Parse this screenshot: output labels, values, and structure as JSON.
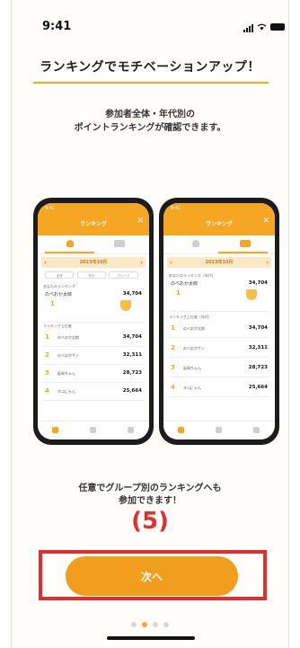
{
  "status_bar": {
    "time": "9:41"
  },
  "page": {
    "title": "ランキングでモチベーションアップ！",
    "description_lines": [
      "参加者全体・年代別の",
      "ポイントランキングが確認できます。"
    ],
    "footer_lines": [
      "任意でグループ別のランキングへも",
      "参加できます！"
    ],
    "step_label": "(5)",
    "next_button": "次へ",
    "page_indicator": {
      "total": 4,
      "active": 2
    }
  },
  "mockup_left": {
    "header_title": "ランキング",
    "month": "2023年10月",
    "chips": [
      "全体",
      "年代",
      "グループ"
    ],
    "my_rank_label": "あなたのランキング",
    "my_name": "のべおか太郎",
    "my_points": "34,704",
    "my_rank": "1",
    "ranking_label": "ランキング上位者",
    "rows": [
      {
        "rank": "1",
        "name": "のべおか太郎",
        "points": "34,704"
      },
      {
        "rank": "2",
        "name": "のべおかサン",
        "points": "32,311"
      },
      {
        "rank": "3",
        "name": "延岡ちゃん",
        "points": "28,723"
      },
      {
        "rank": "4",
        "name": "ネコにゃん",
        "points": "25,664"
      }
    ]
  },
  "mockup_right": {
    "header_title": "ランキング",
    "month": "2023年10月",
    "my_rank_label": "あなたのランキング（年代）",
    "my_name": "のべおか太郎",
    "my_points": "34,704",
    "my_rank": "1",
    "ranking_label": "ランキング上位者（年代）",
    "rows": [
      {
        "rank": "1",
        "name": "のべおか太郎",
        "points": "34,704"
      },
      {
        "rank": "2",
        "name": "のべおかサン",
        "points": "32,311"
      },
      {
        "rank": "3",
        "name": "延岡ちゃん",
        "points": "28,723"
      },
      {
        "rank": "4",
        "name": "ネコにゃん",
        "points": "25,664"
      }
    ]
  },
  "colors": {
    "accent": "#f5a623",
    "button": "#f19e1f",
    "highlight": "#e42e2e"
  }
}
